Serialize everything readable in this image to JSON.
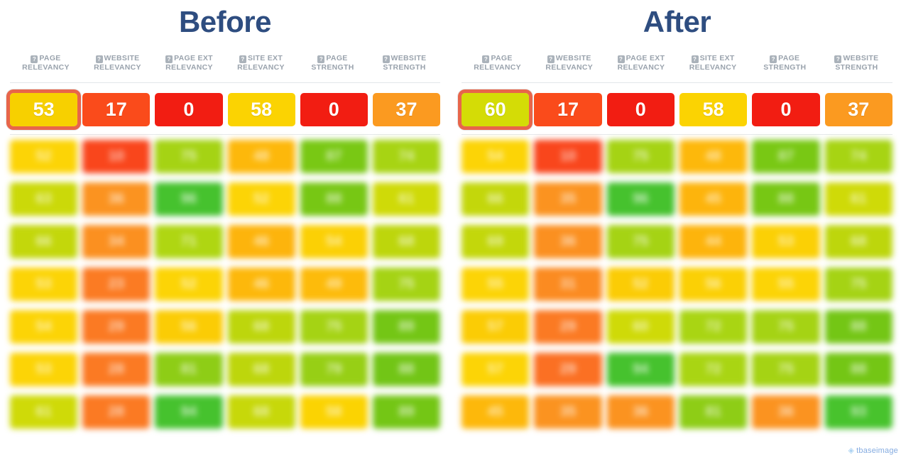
{
  "panels": [
    {
      "id": "before",
      "title": "Before",
      "columns": [
        {
          "line1": "PAGE",
          "line2": "RELEVANCY",
          "icon": "help-icon"
        },
        {
          "line1": "WEBSITE",
          "line2": "RELEVANCY",
          "icon": "help-icon"
        },
        {
          "line1": "PAGE EXT",
          "line2": "RELEVANCY",
          "icon": "help-icon"
        },
        {
          "line1": "SITE EXT",
          "line2": "RELEVANCY",
          "icon": "help-icon"
        },
        {
          "line1": "PAGE",
          "line2": "STRENGTH",
          "icon": "help-icon"
        },
        {
          "line1": "WEBSITE",
          "line2": "STRENGTH",
          "icon": "help-icon"
        }
      ],
      "scores": [
        {
          "value": "53",
          "color": "#f7d000",
          "highlighted": true
        },
        {
          "value": "17",
          "color": "#fa4b1b",
          "highlighted": false
        },
        {
          "value": "0",
          "color": "#f21d12",
          "highlighted": false
        },
        {
          "value": "58",
          "color": "#fbd302",
          "highlighted": false
        },
        {
          "value": "0",
          "color": "#f21d12",
          "highlighted": false
        },
        {
          "value": "37",
          "color": "#fb9a20",
          "highlighted": false
        }
      ],
      "grid_rows": [
        [
          {
            "value": "52",
            "color": "#fcd406"
          },
          {
            "value": "10",
            "color": "#f9461c"
          },
          {
            "value": "75",
            "color": "#a5d314"
          },
          {
            "value": "48",
            "color": "#fdb80b"
          },
          {
            "value": "87",
            "color": "#79c814"
          },
          {
            "value": "74",
            "color": "#a7d413"
          }
        ],
        [
          {
            "value": "63",
            "color": "#cbd909"
          },
          {
            "value": "36",
            "color": "#fb9320"
          },
          {
            "value": "96",
            "color": "#46c22e"
          },
          {
            "value": "52",
            "color": "#fcd406"
          },
          {
            "value": "88",
            "color": "#77c714"
          },
          {
            "value": "61",
            "color": "#cfda08"
          }
        ],
        [
          {
            "value": "66",
            "color": "#c3d70b"
          },
          {
            "value": "34",
            "color": "#fb9020"
          },
          {
            "value": "71",
            "color": "#afd612"
          },
          {
            "value": "46",
            "color": "#fdb40c"
          },
          {
            "value": "54",
            "color": "#fbd005"
          },
          {
            "value": "68",
            "color": "#bdd60c"
          }
        ],
        [
          {
            "value": "53",
            "color": "#fcd406"
          },
          {
            "value": "23",
            "color": "#fb7b23"
          },
          {
            "value": "52",
            "color": "#fcd406"
          },
          {
            "value": "46",
            "color": "#fdb80b"
          },
          {
            "value": "49",
            "color": "#fdbb0b"
          },
          {
            "value": "75",
            "color": "#a5d314"
          }
        ],
        [
          {
            "value": "54",
            "color": "#fcd406"
          },
          {
            "value": "29",
            "color": "#fb7a23"
          },
          {
            "value": "56",
            "color": "#fbcc05"
          },
          {
            "value": "68",
            "color": "#bdd60c"
          },
          {
            "value": "75",
            "color": "#a5d314"
          },
          {
            "value": "89",
            "color": "#74c615"
          }
        ],
        [
          {
            "value": "53",
            "color": "#fcd406"
          },
          {
            "value": "28",
            "color": "#fb7a23"
          },
          {
            "value": "81",
            "color": "#8ecd16"
          },
          {
            "value": "68",
            "color": "#bdd60c"
          },
          {
            "value": "79",
            "color": "#97cf15"
          },
          {
            "value": "88",
            "color": "#72c516"
          }
        ],
        [
          {
            "value": "61",
            "color": "#cfda08"
          },
          {
            "value": "28",
            "color": "#fb7a23"
          },
          {
            "value": "94",
            "color": "#46c22e"
          },
          {
            "value": "68",
            "color": "#c7d80a"
          },
          {
            "value": "58",
            "color": "#fbd302"
          },
          {
            "value": "89",
            "color": "#74c615"
          }
        ]
      ]
    },
    {
      "id": "after",
      "title": "After",
      "columns": [
        {
          "line1": "PAGE",
          "line2": "RELEVANCY",
          "icon": "help-icon"
        },
        {
          "line1": "WEBSITE",
          "line2": "RELEVANCY",
          "icon": "help-icon"
        },
        {
          "line1": "PAGE EXT",
          "line2": "RELEVANCY",
          "icon": "help-icon"
        },
        {
          "line1": "SITE EXT",
          "line2": "RELEVANCY",
          "icon": "help-icon"
        },
        {
          "line1": "PAGE",
          "line2": "STRENGTH",
          "icon": "help-icon"
        },
        {
          "line1": "WEBSITE",
          "line2": "STRENGTH",
          "icon": "help-icon"
        }
      ],
      "scores": [
        {
          "value": "60",
          "color": "#d4dc06",
          "highlighted": true
        },
        {
          "value": "17",
          "color": "#fa4b1b",
          "highlighted": false
        },
        {
          "value": "0",
          "color": "#f21d12",
          "highlighted": false
        },
        {
          "value": "58",
          "color": "#fbd302",
          "highlighted": false
        },
        {
          "value": "0",
          "color": "#f21d12",
          "highlighted": false
        },
        {
          "value": "37",
          "color": "#fb9a20",
          "highlighted": false
        }
      ],
      "grid_rows": [
        [
          {
            "value": "54",
            "color": "#fcd406"
          },
          {
            "value": "10",
            "color": "#f9461c"
          },
          {
            "value": "75",
            "color": "#a5d314"
          },
          {
            "value": "48",
            "color": "#fdb80b"
          },
          {
            "value": "87",
            "color": "#79c814"
          },
          {
            "value": "74",
            "color": "#a7d413"
          }
        ],
        [
          {
            "value": "66",
            "color": "#c3d70b"
          },
          {
            "value": "35",
            "color": "#fb9320"
          },
          {
            "value": "96",
            "color": "#46c22e"
          },
          {
            "value": "45",
            "color": "#fdb40c"
          },
          {
            "value": "88",
            "color": "#77c714"
          },
          {
            "value": "61",
            "color": "#cfda08"
          }
        ],
        [
          {
            "value": "69",
            "color": "#c3d70b"
          },
          {
            "value": "36",
            "color": "#fb9020"
          },
          {
            "value": "75",
            "color": "#a5d314"
          },
          {
            "value": "44",
            "color": "#fdb40c"
          },
          {
            "value": "53",
            "color": "#fbd005"
          },
          {
            "value": "68",
            "color": "#bdd60c"
          }
        ],
        [
          {
            "value": "55",
            "color": "#fcd406"
          },
          {
            "value": "31",
            "color": "#fb8b21"
          },
          {
            "value": "52",
            "color": "#fbcc05"
          },
          {
            "value": "56",
            "color": "#fbd005"
          },
          {
            "value": "55",
            "color": "#fcd406"
          },
          {
            "value": "75",
            "color": "#a5d314"
          }
        ],
        [
          {
            "value": "57",
            "color": "#fbcc05"
          },
          {
            "value": "29",
            "color": "#fb7a23"
          },
          {
            "value": "60",
            "color": "#cfda08"
          },
          {
            "value": "72",
            "color": "#a9d513"
          },
          {
            "value": "75",
            "color": "#a5d314"
          },
          {
            "value": "88",
            "color": "#74c615"
          }
        ],
        [
          {
            "value": "57",
            "color": "#fcd406"
          },
          {
            "value": "29",
            "color": "#fb7023"
          },
          {
            "value": "94",
            "color": "#46c22e"
          },
          {
            "value": "72",
            "color": "#a9d513"
          },
          {
            "value": "75",
            "color": "#a5d314"
          },
          {
            "value": "88",
            "color": "#74c615"
          }
        ],
        [
          {
            "value": "45",
            "color": "#fdb80b"
          },
          {
            "value": "35",
            "color": "#fb9320"
          },
          {
            "value": "36",
            "color": "#fb9320"
          },
          {
            "value": "81",
            "color": "#8ecd16"
          },
          {
            "value": "36",
            "color": "#fb9320"
          },
          {
            "value": "93",
            "color": "#48c32d"
          }
        ]
      ]
    }
  ],
  "watermark": {
    "mark": "◈",
    "text": "tbaseimage"
  },
  "theme": {
    "title_color": "#2e4d80",
    "header_text_color": "#9aa3ad",
    "divider_color": "#e2e6ea",
    "highlight_border": "#e8654a",
    "background": "#ffffff"
  }
}
